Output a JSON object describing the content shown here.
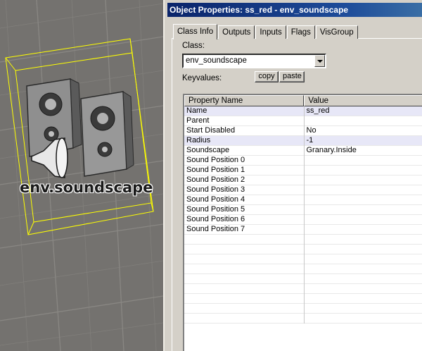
{
  "viewport": {
    "entity_label": "env.soundscape",
    "selection_color": "#ffff00"
  },
  "dialog": {
    "title": "Object Properties: ss_red - env_soundscape",
    "tabs": [
      {
        "label": "Class Info",
        "active": true
      },
      {
        "label": "Outputs",
        "active": false
      },
      {
        "label": "Inputs",
        "active": false
      },
      {
        "label": "Flags",
        "active": false
      },
      {
        "label": "VisGroup",
        "active": false
      }
    ],
    "class_label": "Class:",
    "class_value": "env_soundscape",
    "keyvalues_label": "Keyvalues:",
    "copy_label": "copy",
    "paste_label": "paste",
    "grid": {
      "headers": [
        "Property Name",
        "Value"
      ],
      "rows": [
        {
          "name": "Name",
          "value": "ss_red"
        },
        {
          "name": "Parent",
          "value": ""
        },
        {
          "name": "Start Disabled",
          "value": "No"
        },
        {
          "name": "Radius",
          "value": "-1"
        },
        {
          "name": "Soundscape",
          "value": "Granary.Inside"
        },
        {
          "name": "Sound Position 0",
          "value": ""
        },
        {
          "name": "Sound Position 1",
          "value": ""
        },
        {
          "name": "Sound Position 2",
          "value": ""
        },
        {
          "name": "Sound Position 3",
          "value": ""
        },
        {
          "name": "Sound Position 4",
          "value": ""
        },
        {
          "name": "Sound Position 5",
          "value": ""
        },
        {
          "name": "Sound Position 6",
          "value": ""
        },
        {
          "name": "Sound Position 7",
          "value": ""
        }
      ]
    }
  }
}
